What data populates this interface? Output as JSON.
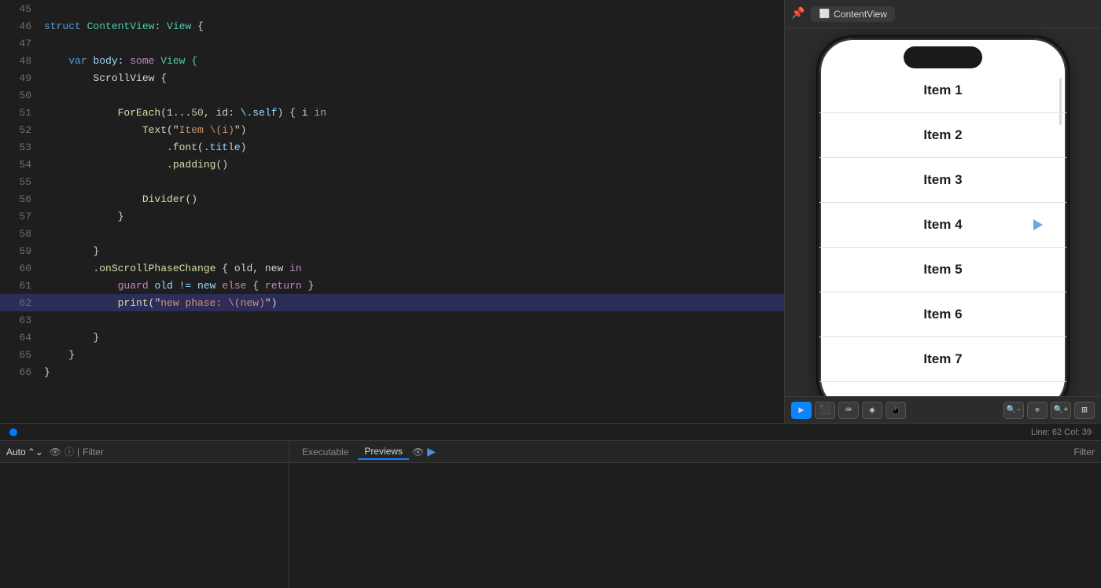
{
  "editor": {
    "lines": [
      {
        "num": "45",
        "content": ""
      },
      {
        "num": "46",
        "tokens": [
          {
            "text": "struct ",
            "class": "kw-blue"
          },
          {
            "text": "ContentView",
            "class": "kw-struct"
          },
          {
            "text": ": ",
            "class": "kw-light"
          },
          {
            "text": "View",
            "class": "kw-type"
          },
          {
            "text": " {",
            "class": "kw-light"
          }
        ]
      },
      {
        "num": "47",
        "content": ""
      },
      {
        "num": "48",
        "tokens": [
          {
            "text": "    ",
            "class": ""
          },
          {
            "text": "var",
            "class": "kw-var"
          },
          {
            "text": " body: ",
            "class": "kw-self"
          },
          {
            "text": "some",
            "class": "kw-some"
          },
          {
            "text": " View {",
            "class": "kw-type"
          }
        ]
      },
      {
        "num": "49",
        "tokens": [
          {
            "text": "        ScrollView {",
            "class": "kw-light"
          }
        ]
      },
      {
        "num": "50",
        "content": ""
      },
      {
        "num": "51",
        "tokens": [
          {
            "text": "            ",
            "class": ""
          },
          {
            "text": "ForEach",
            "class": "kw-method"
          },
          {
            "text": "(1...",
            "class": "kw-light"
          },
          {
            "text": "50",
            "class": "kw-number"
          },
          {
            "text": ", id: ",
            "class": "kw-light"
          },
          {
            "text": "\\.self",
            "class": "kw-self"
          },
          {
            "text": ") { i ",
            "class": "kw-light"
          },
          {
            "text": "in",
            "class": "kw-in-kw"
          }
        ]
      },
      {
        "num": "52",
        "tokens": [
          {
            "text": "                ",
            "class": ""
          },
          {
            "text": "Text",
            "class": "kw-method"
          },
          {
            "text": "(\"",
            "class": "kw-light"
          },
          {
            "text": "Item \\(i)",
            "class": "kw-item-str"
          },
          {
            "text": "\")",
            "class": "kw-light"
          }
        ]
      },
      {
        "num": "53",
        "tokens": [
          {
            "text": "                    .",
            "class": "kw-light"
          },
          {
            "text": "font",
            "class": "kw-modifier"
          },
          {
            "text": "(.",
            "class": "kw-light"
          },
          {
            "text": "title",
            "class": "kw-self"
          },
          {
            "text": ")",
            "class": "kw-light"
          }
        ]
      },
      {
        "num": "54",
        "tokens": [
          {
            "text": "                    .",
            "class": "kw-light"
          },
          {
            "text": "padding",
            "class": "kw-modifier"
          },
          {
            "text": "()",
            "class": "kw-light"
          }
        ]
      },
      {
        "num": "55",
        "content": ""
      },
      {
        "num": "56",
        "tokens": [
          {
            "text": "                ",
            "class": ""
          },
          {
            "text": "Divider",
            "class": "kw-method"
          },
          {
            "text": "()",
            "class": "kw-light"
          }
        ]
      },
      {
        "num": "57",
        "tokens": [
          {
            "text": "            }",
            "class": "kw-light"
          }
        ]
      },
      {
        "num": "58",
        "content": ""
      },
      {
        "num": "59",
        "tokens": [
          {
            "text": "        }",
            "class": "kw-light"
          }
        ]
      },
      {
        "num": "60",
        "tokens": [
          {
            "text": "        .",
            "class": "kw-light"
          },
          {
            "text": "onScrollPhaseChange",
            "class": "kw-modifier"
          },
          {
            "text": " { old, new ",
            "class": "kw-light"
          },
          {
            "text": "in",
            "class": "kw-in-kw"
          }
        ]
      },
      {
        "num": "61",
        "tokens": [
          {
            "text": "            ",
            "class": ""
          },
          {
            "text": "guard",
            "class": "kw-guard"
          },
          {
            "text": " old != new ",
            "class": "kw-self"
          },
          {
            "text": "else",
            "class": "kw-else"
          },
          {
            "text": " { ",
            "class": "kw-light"
          },
          {
            "text": "return",
            "class": "kw-guard"
          },
          {
            "text": " }",
            "class": "kw-light"
          }
        ]
      },
      {
        "num": "62",
        "highlighted": true,
        "tokens": [
          {
            "text": "            ",
            "class": ""
          },
          {
            "text": "print",
            "class": "kw-print"
          },
          {
            "text": "(\"",
            "class": "kw-light"
          },
          {
            "text": "new phase: \\(new)",
            "class": "kw-item-str"
          },
          {
            "text": "\")",
            "class": "kw-light"
          }
        ]
      },
      {
        "num": "63",
        "content": ""
      },
      {
        "num": "64",
        "tokens": [
          {
            "text": "        }",
            "class": "kw-light"
          }
        ]
      },
      {
        "num": "65",
        "tokens": [
          {
            "text": "    }",
            "class": "kw-light"
          }
        ]
      },
      {
        "num": "66",
        "tokens": [
          {
            "text": "}",
            "class": "kw-light"
          }
        ]
      }
    ],
    "status": {
      "line": "Line: 62",
      "col": "Col: 39"
    }
  },
  "preview": {
    "tab_label": "ContentView",
    "phone_items": [
      {
        "label": "Item 1"
      },
      {
        "label": "Item 2"
      },
      {
        "label": "Item 3"
      },
      {
        "label": "Item 4"
      },
      {
        "label": "Item 5"
      },
      {
        "label": "Item 6"
      },
      {
        "label": "Item 7"
      }
    ],
    "toolbar_left": [
      {
        "icon": "▶",
        "name": "play",
        "active": true
      },
      {
        "icon": "⬛",
        "name": "preview-toggle"
      },
      {
        "icon": "⌨",
        "name": "keyboard"
      },
      {
        "icon": "◈",
        "name": "inspect"
      },
      {
        "icon": "📱",
        "name": "device"
      }
    ],
    "toolbar_right": [
      {
        "icon": "🔍-",
        "name": "zoom-out"
      },
      {
        "icon": "100",
        "name": "zoom-level"
      },
      {
        "icon": "🔍+",
        "name": "zoom-reset"
      },
      {
        "icon": "⊞",
        "name": "zoom-fit"
      }
    ]
  },
  "bottom": {
    "left": {
      "auto_label": "Auto",
      "filter_label": "Filter"
    },
    "right": {
      "executable_label": "Executable",
      "previews_label": "Previews",
      "filter_label": "Filter"
    }
  },
  "status_bar": {
    "position": "Line: 62  Col: 39"
  }
}
